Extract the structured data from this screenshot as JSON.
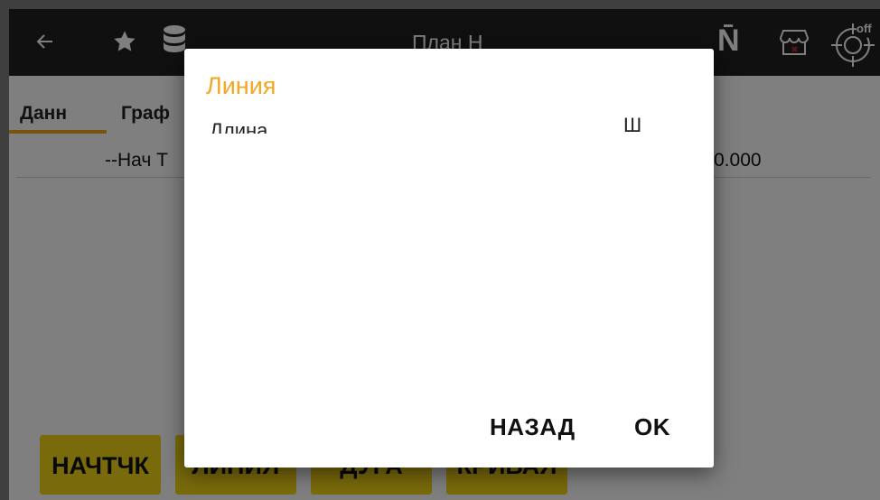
{
  "app_bar": {
    "title": "План Н",
    "brand_letter": "N̄",
    "gps_badge": "off"
  },
  "tabs": [
    {
      "label": "Данн",
      "active": true
    },
    {
      "label": "Граф",
      "active": false
    }
  ],
  "row": {
    "label": "--Нач Т",
    "value": "0.000"
  },
  "buttons": [
    "НАЧТЧК",
    "ЛИНИЯ",
    "ДУГА",
    "КРИВАЯ"
  ],
  "dialog": {
    "title": "Линия",
    "item_left": "Длина",
    "item_right": "Ш",
    "back_label": "НАЗАД",
    "ok_label": "OK"
  },
  "colors": {
    "accent": "#f5a623",
    "button": "#f2d416",
    "app_bar": "#212121"
  }
}
